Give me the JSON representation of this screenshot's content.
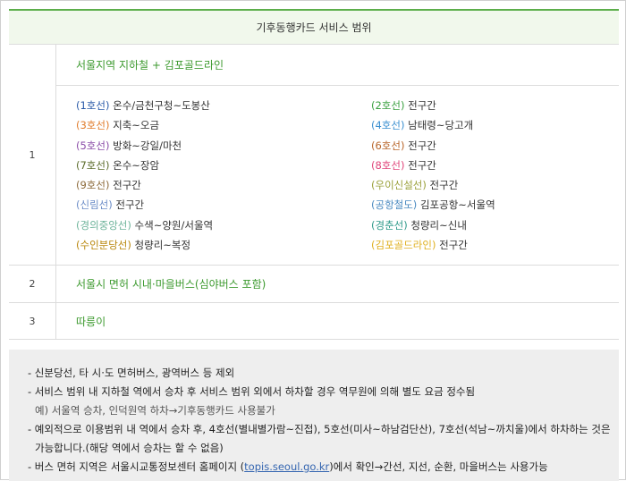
{
  "header": {
    "title": "기후동행카드 서비스 범위"
  },
  "rows": [
    {
      "num": "1",
      "title": "서울지역 지하철 + 김포골드라인",
      "left": [
        {
          "line": "(1호선)",
          "color": "#2a5aa8",
          "area": "온수/금천구청~도봉산"
        },
        {
          "line": "(3호선)",
          "color": "#e07b2a",
          "area": "지축~오금"
        },
        {
          "line": "(5호선)",
          "color": "#8a4ca8",
          "area": "방화~강일/마천"
        },
        {
          "line": "(7호선)",
          "color": "#5a6b2a",
          "area": "온수~장암"
        },
        {
          "line": "(9호선)",
          "color": "#8c6a3a",
          "area": "전구간"
        },
        {
          "line": "(신림선)",
          "color": "#6b8cc7",
          "area": "전구간"
        },
        {
          "line": "(경의중앙선)",
          "color": "#6db39a",
          "area": "수색~양원/서울역"
        },
        {
          "line": "(수인분당선)",
          "color": "#b8860b",
          "area": "청량리~복정"
        }
      ],
      "right": [
        {
          "line": "(2호선)",
          "color": "#3aa040",
          "area": "전구간"
        },
        {
          "line": "(4호선)",
          "color": "#3a8fd0",
          "area": "남태령~당고개"
        },
        {
          "line": "(6호선)",
          "color": "#b8652a",
          "area": "전구간"
        },
        {
          "line": "(8호선)",
          "color": "#e0457a",
          "area": "전구간"
        },
        {
          "line": "(우이신설선)",
          "color": "#9aa03a",
          "area": "전구간"
        },
        {
          "line": "(공항철도)",
          "color": "#4a8ac0",
          "area": "김포공항~서울역"
        },
        {
          "line": "(경춘선)",
          "color": "#2f9a8a",
          "area": "청량리~신내"
        },
        {
          "line": "(김포골드라인)",
          "color": "#e0b020",
          "area": "전구간"
        }
      ]
    },
    {
      "num": "2",
      "title": "서울시 면허 시내·마을버스(심야버스 포함)"
    },
    {
      "num": "3",
      "title": "따릉이"
    }
  ],
  "notes": {
    "n1": "- 신분당선, 타 시·도 면허버스, 광역버스 등 제외",
    "n2": "- 서비스 범위 내 지하철 역에서 승차 후 서비스 범위 외에서 하차할 경우 역무원에 의해 별도 요금 정수됨",
    "n2_example": "예) 서울역 승차, 인덕원역 하차→기후동행카드 사용불가",
    "n3a": "- 예외적으로 이용범위 내 역에서 승차 후, 4호선(별내별가람~진접), 5호선(미사~하남검단산), 7호선(석남~까치울)에서 하차하는 것은",
    "n3b": "  가능합니다.(해당 역에서 승차는 할 수 없음)",
    "n4_pre": "- 버스 면허 지역은 서울시교통정보센터 홈페이지 (",
    "n4_link": "topis.seoul.go.kr",
    "n4_post": ")에서 확인→간선, 지선, 순환, 마을버스는 사용가능"
  }
}
